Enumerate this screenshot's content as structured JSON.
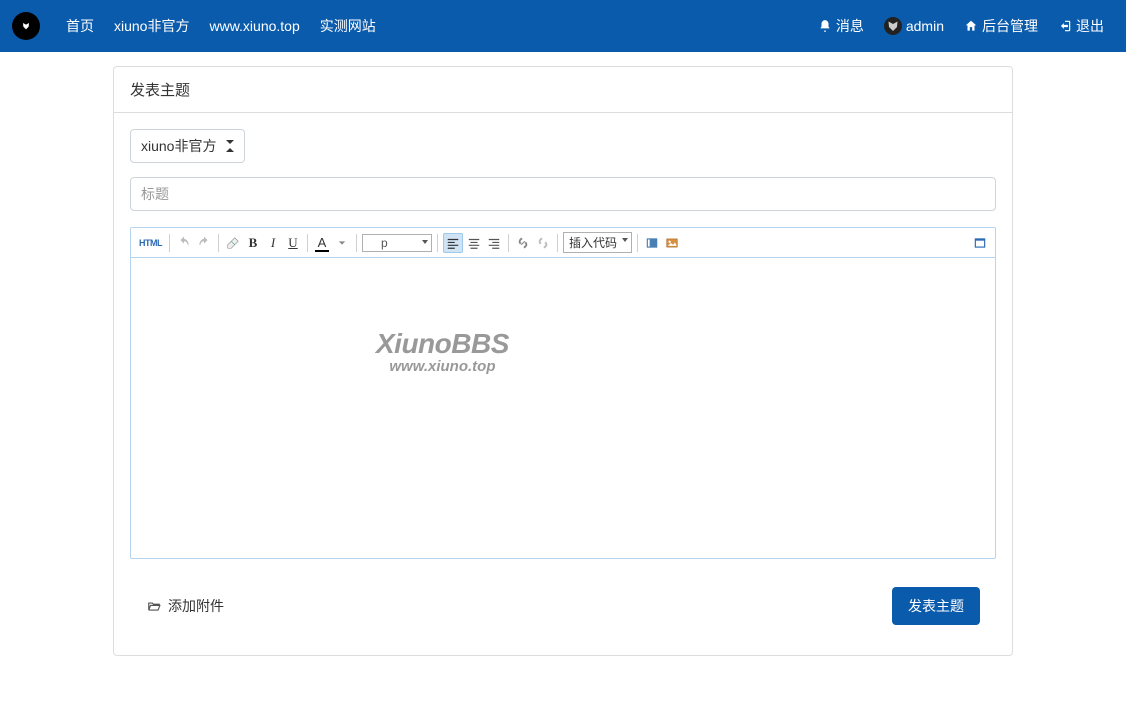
{
  "nav": {
    "home": "首页",
    "link1": "xiuno非官方",
    "link2": "www.xiuno.top",
    "link3": "实测网站",
    "messages": "消息",
    "user": "admin",
    "admin": "后台管理",
    "logout": "退出"
  },
  "card": {
    "title": "发表主题"
  },
  "form": {
    "forum_selected": "xiuno非官方",
    "title_placeholder": "标题"
  },
  "toolbar": {
    "html": "HTML",
    "bold": "B",
    "italic": "I",
    "underline": "U",
    "font_a": "A",
    "format_value": "p",
    "insert_code": "插入代码"
  },
  "watermark": {
    "line1": "XiunoBBS",
    "line2": "www.xiuno.top"
  },
  "footer": {
    "attach": "添加附件",
    "submit": "发表主题"
  }
}
